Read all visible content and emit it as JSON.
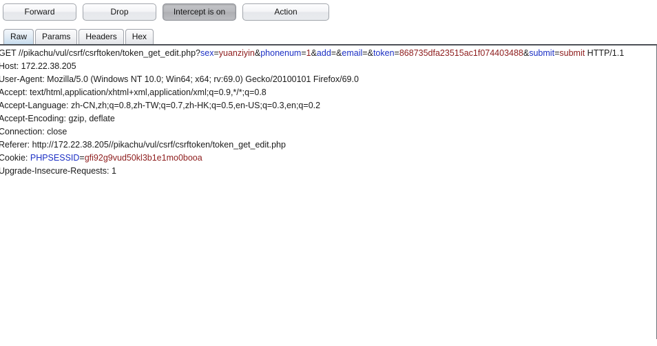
{
  "toolbar": {
    "buttons": [
      {
        "label": "Forward",
        "state": "normal",
        "width": "normal"
      },
      {
        "label": "Drop",
        "state": "normal",
        "width": "normal"
      },
      {
        "label": "Intercept is on",
        "state": "pressed",
        "width": "normal"
      },
      {
        "label": "Action",
        "state": "normal",
        "width": "wide"
      }
    ]
  },
  "tabs": {
    "items": [
      {
        "label": "Raw",
        "active": true
      },
      {
        "label": "Params",
        "active": false
      },
      {
        "label": "Headers",
        "active": false
      },
      {
        "label": "Hex",
        "active": false
      }
    ]
  },
  "colors": {
    "param_key": "#1b2fc4",
    "param_value": "#8d1c1c",
    "text": "#1a1a1a",
    "panel_border": "#4c5056",
    "tab_active": "#c6dcee"
  },
  "request": {
    "lines": [
      {
        "id": "request-line",
        "segments": [
          {
            "text": "GET //pikachu/vul/csrf/csrftoken/token_get_edit.php?",
            "kind": "plain"
          },
          {
            "text": "sex",
            "kind": "key"
          },
          {
            "text": "=",
            "kind": "plain"
          },
          {
            "text": "yuanziyin",
            "kind": "value"
          },
          {
            "text": "&",
            "kind": "plain"
          },
          {
            "text": "phonenum",
            "kind": "key"
          },
          {
            "text": "=",
            "kind": "plain"
          },
          {
            "text": "1",
            "kind": "value"
          },
          {
            "text": "&",
            "kind": "plain"
          },
          {
            "text": "add",
            "kind": "key"
          },
          {
            "text": "=&",
            "kind": "plain"
          },
          {
            "text": "email",
            "kind": "key"
          },
          {
            "text": "=&",
            "kind": "plain"
          },
          {
            "text": "token",
            "kind": "key"
          },
          {
            "text": "=",
            "kind": "plain"
          },
          {
            "text": "868735dfa23515ac1f074403488",
            "kind": "value"
          },
          {
            "text": "&",
            "kind": "plain"
          },
          {
            "text": "submit",
            "kind": "key"
          },
          {
            "text": "=",
            "kind": "plain"
          },
          {
            "text": "submit",
            "kind": "value"
          },
          {
            "text": " HTTP/1.1",
            "kind": "plain"
          }
        ]
      },
      {
        "id": "header-host",
        "segments": [
          {
            "text": "Host: 172.22.38.205",
            "kind": "plain"
          }
        ]
      },
      {
        "id": "header-user-agent",
        "segments": [
          {
            "text": "User-Agent: Mozilla/5.0 (Windows NT 10.0; Win64; x64; rv:69.0) Gecko/20100101 Firefox/69.0",
            "kind": "plain"
          }
        ]
      },
      {
        "id": "header-accept",
        "segments": [
          {
            "text": "Accept: text/html,application/xhtml+xml,application/xml;q=0.9,*/*;q=0.8",
            "kind": "plain"
          }
        ]
      },
      {
        "id": "header-accept-language",
        "segments": [
          {
            "text": "Accept-Language: zh-CN,zh;q=0.8,zh-TW;q=0.7,zh-HK;q=0.5,en-US;q=0.3,en;q=0.2",
            "kind": "plain"
          }
        ]
      },
      {
        "id": "header-accept-encoding",
        "segments": [
          {
            "text": "Accept-Encoding: gzip, deflate",
            "kind": "plain"
          }
        ]
      },
      {
        "id": "header-connection",
        "segments": [
          {
            "text": "Connection: close",
            "kind": "plain"
          }
        ]
      },
      {
        "id": "header-referer",
        "segments": [
          {
            "text": "Referer: http://172.22.38.205//pikachu/vul/csrf/csrftoken/token_get_edit.php",
            "kind": "plain"
          }
        ]
      },
      {
        "id": "header-cookie",
        "segments": [
          {
            "text": "Cookie: ",
            "kind": "plain"
          },
          {
            "text": "PHPSESSID",
            "kind": "key"
          },
          {
            "text": "=",
            "kind": "plain"
          },
          {
            "text": "gfi92g9vud50kl3b1e1mo0booa",
            "kind": "value"
          }
        ]
      },
      {
        "id": "header-upgrade-insecure-requests",
        "segments": [
          {
            "text": "Upgrade-Insecure-Requests: 1",
            "kind": "plain"
          }
        ]
      }
    ]
  }
}
